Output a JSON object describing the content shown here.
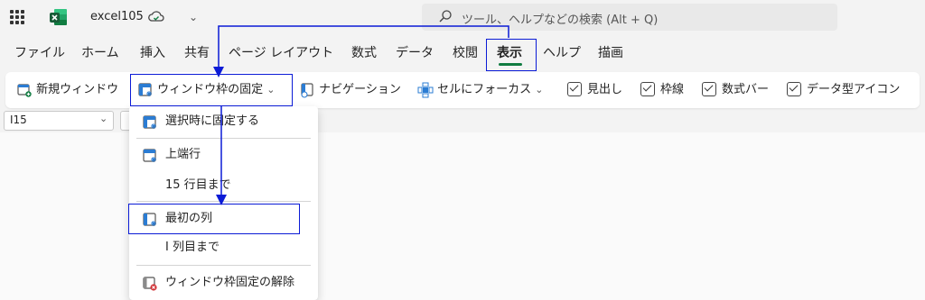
{
  "app": {
    "filename": "excel105",
    "search_placeholder": "ツール、ヘルプなどの検索 (Alt + Q)"
  },
  "menu": [
    "ファイル",
    "ホーム",
    "挿入",
    "共有",
    "ページ レイアウト",
    "数式",
    "データ",
    "校閲",
    "表示",
    "ヘルプ",
    "描画"
  ],
  "active_menu": "表示",
  "ribbon": {
    "new_window": "新規ウィンドウ",
    "freeze_panes": "ウィンドウ枠の固定",
    "navigation": "ナビゲーション",
    "focus_cell": "セルにフォーカス",
    "headings": "見出し",
    "gridlines": "枠線",
    "formula_bar": "数式バー",
    "data_type_icons": "データ型アイコン"
  },
  "name_box": "I15",
  "dropdown": {
    "freeze_selection": "選択時に固定する",
    "top_row": "上端行",
    "top_row_sub": "15 行目まで",
    "first_column": "最初の列",
    "first_column_sub": "I 列目まで",
    "unfreeze": "ウィンドウ枠固定の解除"
  },
  "colors": {
    "accent_green": "#107c41",
    "annotation_blue": "#0b1bd6",
    "icon_blue": "#2b7cd3",
    "unfreeze_red": "#d13438"
  }
}
